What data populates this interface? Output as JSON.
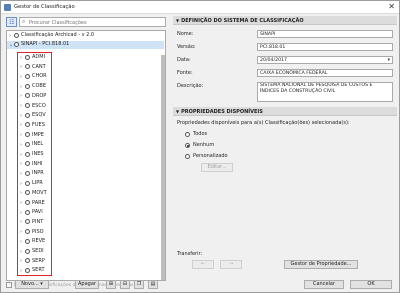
{
  "window": {
    "title": "Gestor de Classificação",
    "close_glyph": "✕"
  },
  "search": {
    "placeholder": "Procurar Classificações"
  },
  "tree": {
    "roots": [
      {
        "label": "Classificação Archicad - v 2.0",
        "expanded": false
      },
      {
        "label": "SINAPI - PCI.818.01",
        "expanded": true
      }
    ],
    "children": [
      "ADMI",
      "CANT",
      "CHOR",
      "COBE",
      "DROP",
      "ESCO",
      "ESQV",
      "FUES",
      "IMPE",
      "INEL",
      "INES",
      "INHI",
      "INPR",
      "LIPR",
      "MOVT",
      "PARE",
      "PAVI",
      "PINT",
      "PISO",
      "REVE",
      "SEDI",
      "SERP",
      "SERT"
    ]
  },
  "left_footer": {
    "checkbox_label": "Mostrar as classificações diferentes mas associadas"
  },
  "buttons": {
    "new": "Novo...",
    "delete": "Apagar",
    "cancel": "Cancelar",
    "ok": "OK",
    "edit": "Editar...",
    "property_manager": "Gestor de Propriedade..."
  },
  "definition": {
    "header": "DEFINIÇÃO DO SISTEMA DE CLASSIFICAÇÃO",
    "fields": [
      {
        "label": "Nome:",
        "value": "SINAPI"
      },
      {
        "label": "Versão:",
        "value": "PCI.818.01"
      },
      {
        "label": "Data:",
        "value": "20/04/2017"
      },
      {
        "label": "Fonte:",
        "value": "CAIXA ECONÔMICA FEDERAL"
      },
      {
        "label": "Descrição:",
        "value": "SISTEMA NACIONAL DE PESQUISA DE CUSTOS E ÍNDICES DA CONSTRUÇÃO CIVIL"
      }
    ]
  },
  "properties": {
    "header": "PROPRIEDADES DISPONÍVEIS",
    "intro": "Propriedades disponíveis para a(s) Classificação(ões) selecionada(s):",
    "options": [
      {
        "label": "Todos",
        "selected": false
      },
      {
        "label": "Nenhum",
        "selected": true
      },
      {
        "label": "Personalizado",
        "selected": false
      }
    ],
    "transfer_label": "Transferir:"
  },
  "colors": {
    "highlight": "#e1232a",
    "selection": "#cfe3f7",
    "accent": "#2f5fa8"
  }
}
